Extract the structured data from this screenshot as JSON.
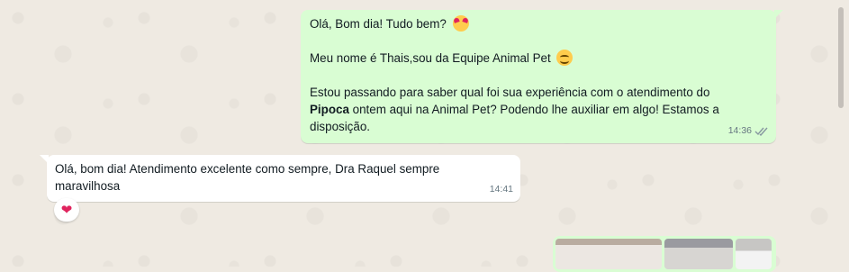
{
  "messages": [
    {
      "direction": "out",
      "lines": [
        "Olá, Bom dia! Tudo bem?",
        "Meu nome é Thais,sou da  Equipe Animal Pet",
        "Estou passando para saber qual foi sua experiência com o atendimento do",
        "Pipoca",
        " ontem aqui na Animal Pet? Podendo lhe auxiliar em algo! Estamos a",
        "disposição."
      ],
      "emoji_1": "smiling-face-with-hearts-icon",
      "emoji_2": "smiling-face-icon",
      "time": "14:36",
      "status_icon": "double-check-icon"
    },
    {
      "direction": "in",
      "lines": [
        "Olá, bom dia! Atendimento excelente como sempre, Dra Raquel sempre",
        "maravilhosa"
      ],
      "time": "14:41",
      "reaction": "❤"
    }
  ],
  "colors": {
    "outgoing_bubble": "#d9fdd3",
    "incoming_bubble": "#ffffff",
    "background": "#efeae2",
    "meta_text": "#667781",
    "read_check": "#8696a0"
  }
}
